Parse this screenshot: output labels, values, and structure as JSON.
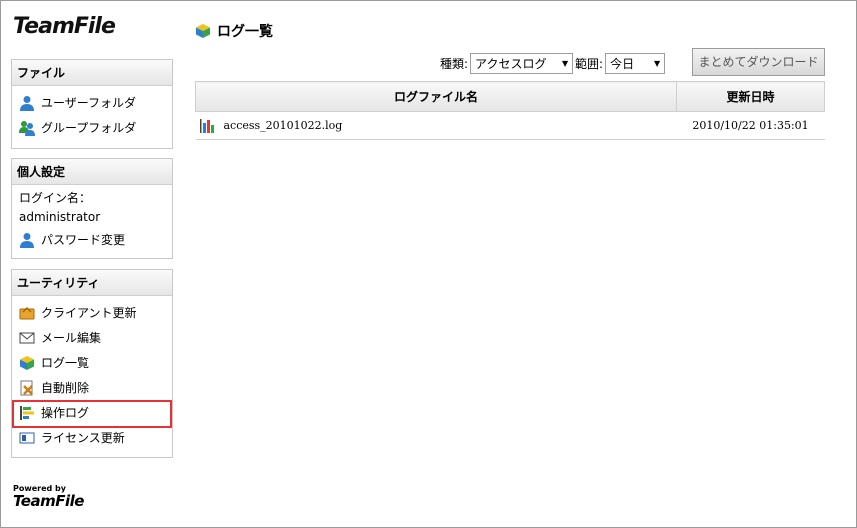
{
  "app": {
    "logo": "TeamFile",
    "powered_by": "Powered by",
    "powered_logo": "TeamFile"
  },
  "sidebar": {
    "file": {
      "title": "ファイル",
      "items": [
        {
          "label": "ユーザーフォルダ",
          "icon": "user-icon"
        },
        {
          "label": "グループフォルダ",
          "icon": "group-icon"
        }
      ]
    },
    "personal": {
      "title": "個人設定",
      "login_label": "ログイン名：",
      "login_name": "administrator",
      "password_label": "パスワード変更"
    },
    "utility": {
      "title": "ユーティリティ",
      "items": [
        {
          "label": "クライアント更新",
          "icon": "client-update-icon"
        },
        {
          "label": "メール編集",
          "icon": "mail-icon"
        },
        {
          "label": "ログ一覧",
          "icon": "cube-icon"
        },
        {
          "label": "自動削除",
          "icon": "auto-delete-icon"
        },
        {
          "label": "操作ログ",
          "icon": "operation-log-icon"
        },
        {
          "label": "ライセンス更新",
          "icon": "license-icon"
        }
      ]
    }
  },
  "main": {
    "title": "ログ一覧",
    "filters": {
      "type_label": "種類:",
      "type_value": "アクセスログ",
      "range_label": "範囲:",
      "range_value": "今日",
      "download_button": "まとめてダウンロード"
    },
    "table": {
      "columns": [
        "ログファイル名",
        "更新日時"
      ],
      "rows": [
        {
          "file": "access_20101022.log",
          "updated": "2010/10/22 01:35:01"
        }
      ]
    }
  },
  "colors": {
    "highlight": "#e53333"
  }
}
